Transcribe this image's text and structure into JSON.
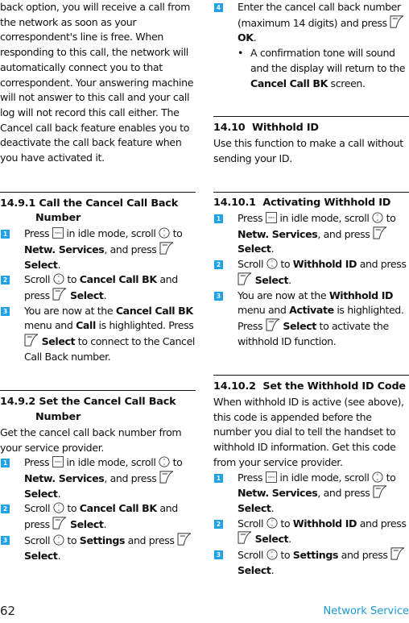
{
  "page": {
    "number": "62",
    "section_name": "Network Service",
    "accent_color": "#1fa3e6"
  },
  "icons": {
    "menu_key": "menu-key-icon",
    "nav_scroll": "navigation-scroll-icon",
    "soft_key": "left-soft-key-icon"
  },
  "left": {
    "intro": "back option, you will receive a call from the network as soon as your correspondent's line is free. When responding to this call, the network will automatically connect you to that correspondent. Your answering machine will not answer to this call and your call log will not record this call either. The Cancel call back feature enables you to deactivate the call back feature when you have activated it.",
    "s1": {
      "heading_num": "14.9.1",
      "heading_a": "Call the Cancel Call Back",
      "heading_b": "Number",
      "steps": [
        {
          "n": "1",
          "t1": "Press",
          "t2": "in idle mode, scroll",
          "t3": "to",
          "b1": "Netw. Services",
          "t4": ", and press",
          "b2": "Select",
          "t5": "."
        },
        {
          "n": "2",
          "t1": "Scroll",
          "t2": "to",
          "b1": "Cancel Call BK",
          "t3": "and press",
          "b2": "Select",
          "t4": "."
        },
        {
          "n": "3",
          "t1": "You are now at the",
          "b1": "Cancel Call BK",
          "t2": "menu and",
          "b2": "Call",
          "t3": "is highlighted. Press",
          "b3": "Select",
          "t4": "to connect to the Cancel Call Back number."
        }
      ]
    },
    "s2": {
      "heading_num": "14.9.2",
      "heading_a": "Set the Cancel Call Back",
      "heading_b": "Number",
      "intro": "Get the cancel call back number from your service provider.",
      "steps": [
        {
          "n": "1",
          "t1": "Press",
          "t2": "in idle mode, scroll",
          "t3": "to",
          "b1": "Netw. Services",
          "t4": ", and press",
          "b2": "Select",
          "t5": "."
        },
        {
          "n": "2",
          "t1": "Scroll",
          "t2": "to",
          "b1": "Cancel Call BK",
          "t3": "and press",
          "b2": "Select",
          "t4": "."
        },
        {
          "n": "3",
          "t1": "Scroll",
          "t2": "to",
          "b1": "Settings",
          "t3": "and press",
          "b2": "Select",
          "t4": "."
        }
      ]
    }
  },
  "right": {
    "step4": {
      "n": "4",
      "t1": "Enter the cancel call back number (maximum 14 digits) and press",
      "b1": "OK",
      "t2": ".",
      "bullet": "•",
      "bt1": "A confirmation tone will sound and the display will return to the",
      "bb1": "Cancel Call BK",
      "bt2": "screen."
    },
    "s3": {
      "heading_num": "14.10",
      "heading": "Withhold ID",
      "intro": "Use this function to make a call without sending your ID."
    },
    "s4": {
      "heading_num": "14.10.1",
      "heading": "Activating Withhold ID",
      "steps": [
        {
          "n": "1",
          "t1": "Press",
          "t2": "in idle mode, scroll",
          "t3": "to",
          "b1": "Netw. Services",
          "t4": ", and press",
          "b2": "Select",
          "t5": "."
        },
        {
          "n": "2",
          "t1": "Scroll",
          "t2": "to",
          "b1": "Withhold ID",
          "t3": "and press",
          "b2": "Select",
          "t4": "."
        },
        {
          "n": "3",
          "t1": "You are now at the",
          "b1": "Withhold ID",
          "t2": "menu and",
          "b2": "Activate",
          "t3": "is highlighted. Press",
          "b3": "Select",
          "t4": "to activate the withhold ID function."
        }
      ]
    },
    "s5": {
      "heading_num": "14.10.2",
      "heading": "Set the Withhold ID Code",
      "intro": "When withhold ID is active (see above), this code is appended before the number you dial to tell the handset to withhold ID information. Get this code from your service provider.",
      "steps": [
        {
          "n": "1",
          "t1": "Press",
          "t2": "in idle mode, scroll",
          "t3": "to",
          "b1": "Netw. Services",
          "t4": ", and press",
          "b2": "Select",
          "t5": "."
        },
        {
          "n": "2",
          "t1": "Scroll",
          "t2": "to",
          "b1": "Withhold ID",
          "t3": "and press",
          "b2": "Select",
          "t4": "."
        },
        {
          "n": "3",
          "t1": "Scroll",
          "t2": "to",
          "b1": "Settings",
          "t3": "and press",
          "b2": "Select",
          "t4": "."
        }
      ]
    }
  }
}
